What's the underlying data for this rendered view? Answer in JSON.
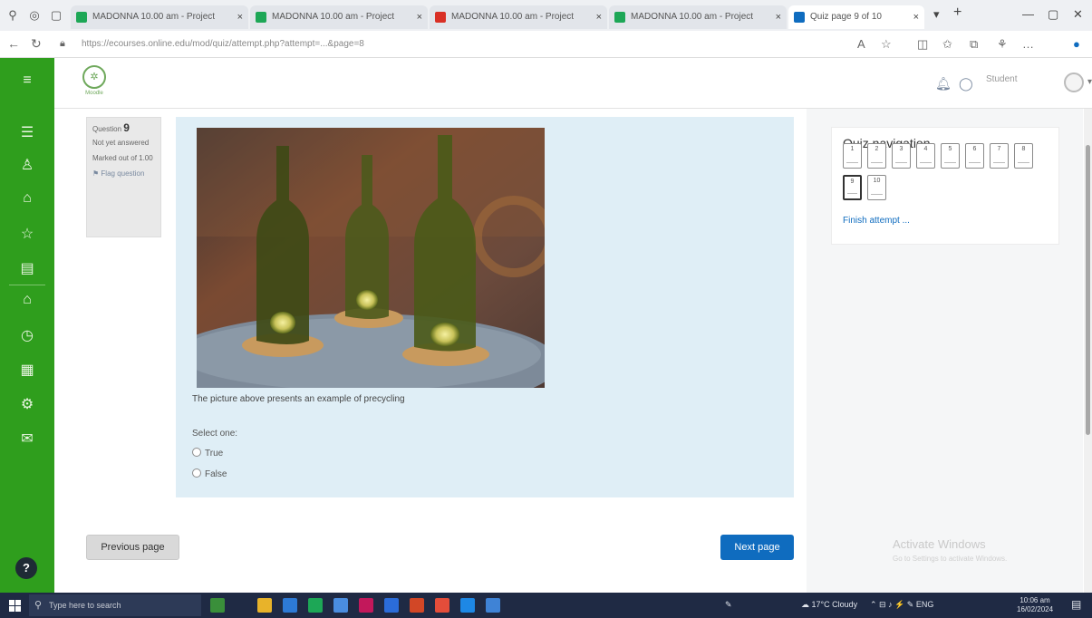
{
  "browser": {
    "tabs": [
      {
        "label": "MADONNA 10.00 am - Project",
        "favicon_color": "#1da756"
      },
      {
        "label": "MADONNA 10.00 am - Project",
        "favicon_color": "#1da756"
      },
      {
        "label": "MADONNA 10.00 am - Project",
        "favicon_color": "#d93025"
      },
      {
        "label": "MADONNA 10.00 am - Project",
        "favicon_color": "#1da756"
      },
      {
        "label": "Quiz page 9 of 10",
        "favicon_color": "#0f6cbf"
      }
    ],
    "url": "https://ecourses.online.edu/mod/quiz/attempt.php?attempt=...&page=8",
    "new_tab": "+"
  },
  "header": {
    "logo_text": "Moodle",
    "user_name": "Student"
  },
  "question": {
    "number": "9",
    "label": "Question",
    "status": "Not yet answered",
    "marks": "Marked out of 1.00",
    "flag": "Flag question",
    "text": "The picture above presents an example of precycling",
    "prompt": "Select one:",
    "options": [
      "True",
      "False"
    ]
  },
  "navigation": {
    "title": "Quiz navigation",
    "buttons": [
      "1",
      "2",
      "3",
      "4",
      "5",
      "6",
      "7",
      "8",
      "9",
      "10"
    ],
    "current": "9",
    "finish": "Finish attempt ..."
  },
  "footer": {
    "prev": "Previous page",
    "next": "Next page"
  },
  "watermark": {
    "title": "Activate Windows",
    "subtitle": "Go to Settings to activate Windows."
  },
  "taskbar": {
    "search_placeholder": "Type here to search",
    "weather": "17°C Cloudy",
    "time": "10:06 am",
    "date": "16/02/2024"
  },
  "colors": {
    "drawer_green": "#2f9e1d",
    "primary_blue": "#0f6cbf",
    "question_bg": "#dfeef6"
  }
}
